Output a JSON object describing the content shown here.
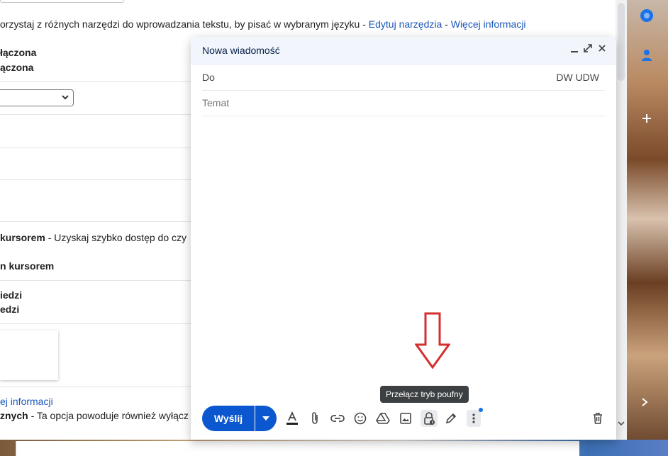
{
  "settings_page": {
    "intro_text": "orzystaj z różnych narzędzi do wprowadzania tekstu, by pisać w wybranym języku - ",
    "edit_tools_link": "Edytuj narzędzia",
    "separator": " - ",
    "more_info_link": "Więcej informacji",
    "option_on": "łączona",
    "option_off": "ączona",
    "hover_label": "kursorem",
    "hover_desc": " - Uzyskaj szybko dostęp do czy",
    "hover_option": "n kursorem",
    "reply_option_1": "iedzi",
    "reply_option_2": "edzi",
    "more_info_link_2": "ej informacji",
    "bottom_bold": "znych",
    "bottom_desc": " - Ta opcja powoduje również wyłącz"
  },
  "compose": {
    "title": "Nowa wiadomość",
    "to_label": "Do",
    "cc_bcc_label": "DW UDW",
    "subject_placeholder": "Temat",
    "send_label": "Wyślij",
    "tooltip": "Przełącz tryb poufny"
  },
  "toolbar_icons": [
    "formatting-icon",
    "attach-icon",
    "link-icon",
    "emoji-icon",
    "drive-icon",
    "photo-icon",
    "confidential-mode-icon",
    "signature-icon",
    "more-options-icon",
    "delete-icon"
  ],
  "colors": {
    "send_button": "#0b57d0",
    "header_bg": "#f2f6fc",
    "link": "#1a57b8",
    "annotation_arrow": "#d32f2f"
  }
}
